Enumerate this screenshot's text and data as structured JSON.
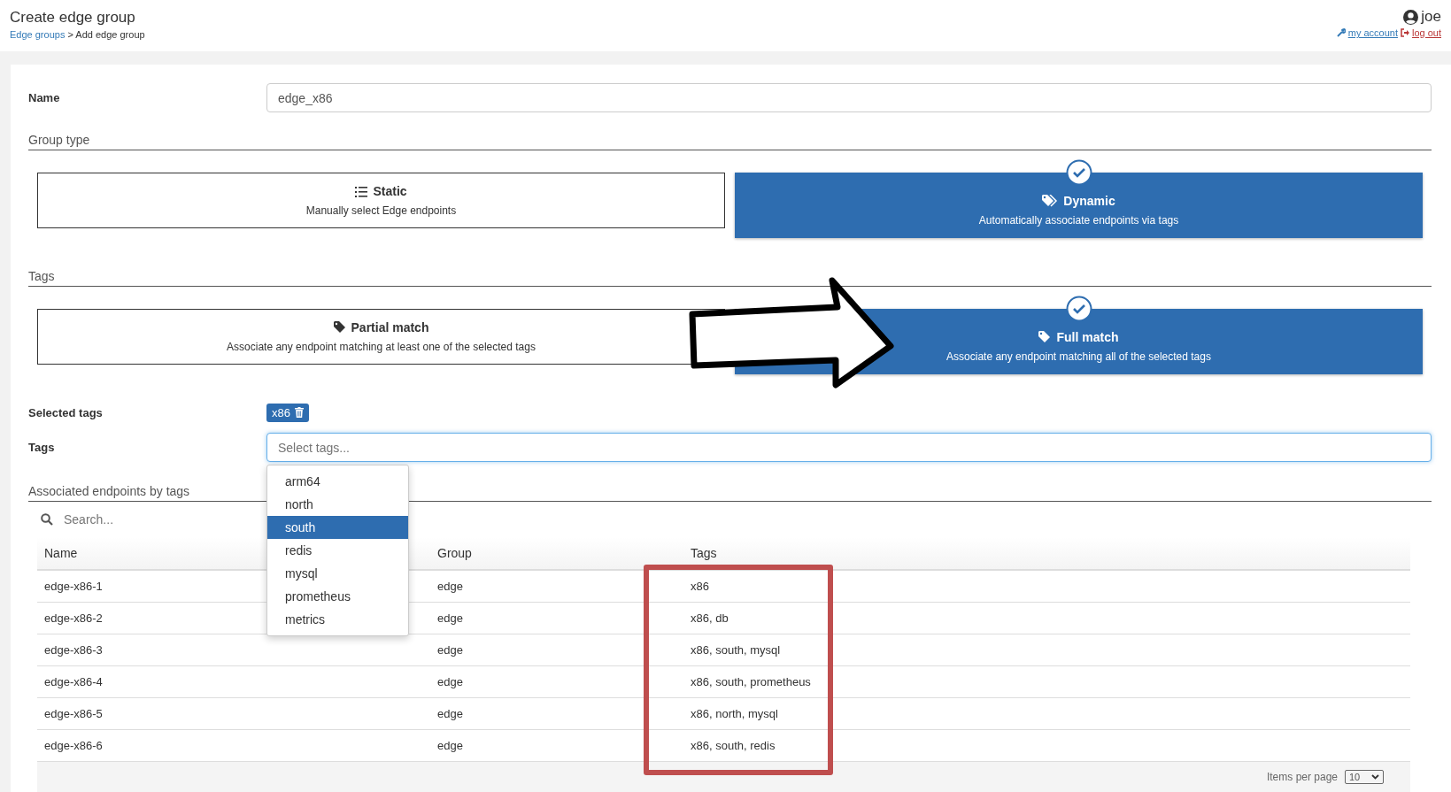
{
  "header": {
    "title": "Create edge group",
    "breadcrumb": {
      "link": "Edge groups",
      "current": "> Add edge group"
    },
    "user": {
      "name": "joe",
      "my_account": "my account",
      "log_out": "log out"
    }
  },
  "form": {
    "name": {
      "label": "Name",
      "value": "edge_x86"
    },
    "group_type": {
      "title": "Group type",
      "options": [
        {
          "kind": "list",
          "title": "Static",
          "description": "Manually select Edge endpoints",
          "selected": false
        },
        {
          "kind": "tags",
          "title": "Dynamic",
          "description": "Automatically associate endpoints via tags",
          "selected": true
        }
      ]
    },
    "tags_match": {
      "title": "Tags",
      "options": [
        {
          "kind": "tag",
          "title": "Partial match",
          "description": "Associate any endpoint matching at least one of the selected tags",
          "selected": false
        },
        {
          "kind": "tag",
          "title": "Full match",
          "description": "Associate any endpoint matching all of the selected tags",
          "selected": true
        }
      ]
    },
    "selected_tags": {
      "label": "Selected tags",
      "tags": [
        "x86"
      ]
    },
    "tags_field": {
      "label": "Tags",
      "placeholder": "Select tags...",
      "options": [
        {
          "label": "arm64",
          "selected": false
        },
        {
          "label": "north",
          "selected": false
        },
        {
          "label": "south",
          "selected": true
        },
        {
          "label": "redis",
          "selected": false
        },
        {
          "label": "mysql",
          "selected": false
        },
        {
          "label": "prometheus",
          "selected": false
        },
        {
          "label": "metrics",
          "selected": false
        }
      ]
    }
  },
  "endpoints": {
    "title": "Associated endpoints by tags",
    "search": {
      "placeholder": "Search..."
    },
    "columns": [
      "Name",
      "Group",
      "Tags"
    ],
    "rows": [
      [
        "edge-x86-1",
        "edge",
        "x86"
      ],
      [
        "edge-x86-2",
        "edge",
        "x86, db"
      ],
      [
        "edge-x86-3",
        "edge",
        "x86, south, mysql"
      ],
      [
        "edge-x86-4",
        "edge",
        "x86, south, prometheus"
      ],
      [
        "edge-x86-5",
        "edge",
        "x86, north, mysql"
      ],
      [
        "edge-x86-6",
        "edge",
        "x86, south, redis"
      ]
    ],
    "items_per_page": {
      "label": "Items per page",
      "value": "10"
    }
  }
}
